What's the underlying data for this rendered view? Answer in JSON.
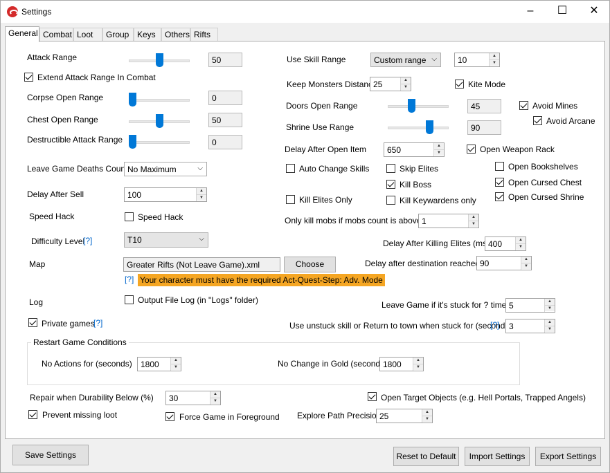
{
  "window": {
    "title": "Settings",
    "minimize": "–",
    "maximize": "☐",
    "close": "✕"
  },
  "tabs": [
    "General",
    "Combat",
    "Loot",
    "Group",
    "Keys",
    "Others",
    "Rifts"
  ],
  "left": {
    "attack_range": {
      "label": "Attack Range",
      "value": "50",
      "level": 0.5
    },
    "extend_attack": {
      "label": "Extend Attack Range In Combat",
      "checked": true
    },
    "corpse_open": {
      "label": "Corpse Open Range",
      "value": "0",
      "level": 0
    },
    "chest_open": {
      "label": "Chest Open Range",
      "value": "50",
      "level": 0.5
    },
    "destructible": {
      "label": "Destructible Attack Range",
      "value": "0",
      "level": 0
    },
    "leave_deaths": {
      "label": "Leave Game Deaths Count",
      "value": "No Maximum"
    },
    "delay_sell": {
      "label": "Delay After Sell",
      "value": "100"
    },
    "speed_hack": {
      "label": "Speed Hack",
      "cb_label": "Speed Hack",
      "checked": false
    },
    "difficulty": {
      "label": "Difficulty Level",
      "help": "[?]",
      "value": "T10"
    },
    "map": {
      "label": "Map",
      "value": "Greater Rifts (Not Leave Game).xml",
      "choose": "Choose",
      "help": "[?]",
      "warning": "Your character must have the required Act-Quest-Step: Adv. Mode"
    },
    "log": {
      "label": "Log",
      "cb_label": "Output File Log (in \"Logs\" folder)",
      "checked": false
    },
    "private_games": {
      "label": "Private games",
      "help": "[?]",
      "checked": true
    }
  },
  "right": {
    "use_skill_range": {
      "label": "Use Skill Range",
      "select": "Custom range",
      "value": "10"
    },
    "keep_distance": {
      "label": "Keep Monsters Distance",
      "value": "25"
    },
    "kite_mode": {
      "label": "Kite Mode",
      "checked": true
    },
    "doors_open": {
      "label": "Doors Open Range",
      "value": "45",
      "level": 0.38
    },
    "shrine_use": {
      "label": "Shrine Use Range",
      "value": "90",
      "level": 0.72
    },
    "avoid_mines": {
      "label": "Avoid Mines",
      "checked": true
    },
    "avoid_arcane": {
      "label": "Avoid Arcane",
      "checked": true
    },
    "delay_open_item": {
      "label": "Delay After Open Item",
      "value": "650"
    },
    "open_weapon_rack": {
      "label": "Open Weapon Rack",
      "checked": true
    },
    "auto_change_skills": {
      "label": "Auto Change Skills",
      "checked": false
    },
    "skip_elites": {
      "label": "Skip Elites",
      "checked": false
    },
    "open_bookshelves": {
      "label": "Open Bookshelves",
      "checked": false
    },
    "kill_boss": {
      "label": "Kill Boss",
      "checked": true
    },
    "open_cursed_chest": {
      "label": "Open Cursed Chest",
      "checked": true
    },
    "kill_elites_only": {
      "label": "Kill Elites Only",
      "checked": false
    },
    "kill_keywardens": {
      "label": "Kill Keywardens only",
      "checked": false
    },
    "open_cursed_shrine": {
      "label": "Open Cursed Shrine",
      "checked": true
    },
    "mobs_count": {
      "label": "Only kill mobs if mobs count is above",
      "value": "1"
    },
    "delay_elites": {
      "label": "Delay After Killing Elites (ms)",
      "value": "400"
    },
    "delay_destination": {
      "label": "Delay after destination reached",
      "value": "90"
    },
    "leave_stuck": {
      "label": "Leave Game if it's stuck for ? times",
      "value": "5"
    },
    "unstuck": {
      "label": "Use unstuck skill or Return to town when stuck for (seconds)",
      "help": "[?]",
      "value": "3"
    }
  },
  "restart": {
    "title": "Restart Game Conditions",
    "no_actions": {
      "label": "No Actions for (seconds)",
      "value": "1800"
    },
    "no_gold": {
      "label": "No Change in Gold (seconds)",
      "value": "1800"
    }
  },
  "bottom": {
    "repair": {
      "label": "Repair when Durability Below (%)",
      "value": "30"
    },
    "open_target": {
      "label": "Open Target Objects (e.g. Hell Portals, Trapped Angels)",
      "checked": true
    },
    "prevent_loot": {
      "label": "Prevent missing loot",
      "checked": true
    },
    "force_fg": {
      "label": "Force Game in Foreground",
      "checked": true
    },
    "explore": {
      "label": "Explore Path Precision",
      "value": "25"
    }
  },
  "footer": {
    "save": "Save Settings",
    "reset": "Reset to Default",
    "import": "Import Settings",
    "export": "Export Settings"
  }
}
